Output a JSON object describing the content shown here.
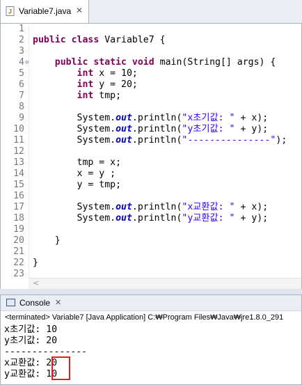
{
  "editor": {
    "tab_label": "Variable7.java",
    "tab_close": "✕",
    "lines": [
      {
        "n": "1",
        "parts": []
      },
      {
        "n": "2",
        "parts": [
          {
            "t": "public class",
            "c": "kw"
          },
          {
            "t": " Variable7 {",
            "c": ""
          }
        ]
      },
      {
        "n": "3",
        "parts": []
      },
      {
        "n": "4",
        "fold": "⊖",
        "parts": [
          {
            "t": "    ",
            "c": ""
          },
          {
            "t": "public static void",
            "c": "kw"
          },
          {
            "t": " main(String[] args) {",
            "c": ""
          }
        ]
      },
      {
        "n": "5",
        "parts": [
          {
            "t": "        ",
            "c": ""
          },
          {
            "t": "int",
            "c": "kw"
          },
          {
            "t": " x = 10;",
            "c": ""
          }
        ]
      },
      {
        "n": "6",
        "parts": [
          {
            "t": "        ",
            "c": ""
          },
          {
            "t": "int",
            "c": "kw"
          },
          {
            "t": " y = 20;",
            "c": ""
          }
        ]
      },
      {
        "n": "7",
        "parts": [
          {
            "t": "        ",
            "c": ""
          },
          {
            "t": "int",
            "c": "kw"
          },
          {
            "t": " tmp;",
            "c": ""
          }
        ]
      },
      {
        "n": "8",
        "parts": []
      },
      {
        "n": "9",
        "parts": [
          {
            "t": "        System.",
            "c": ""
          },
          {
            "t": "out",
            "c": "st"
          },
          {
            "t": ".println(",
            "c": ""
          },
          {
            "t": "\"x초기값: \"",
            "c": "str"
          },
          {
            "t": " + x);",
            "c": ""
          }
        ]
      },
      {
        "n": "10",
        "parts": [
          {
            "t": "        System.",
            "c": ""
          },
          {
            "t": "out",
            "c": "st"
          },
          {
            "t": ".println(",
            "c": ""
          },
          {
            "t": "\"y초기값: \"",
            "c": "str"
          },
          {
            "t": " + y);",
            "c": ""
          }
        ]
      },
      {
        "n": "11",
        "parts": [
          {
            "t": "        System.",
            "c": ""
          },
          {
            "t": "out",
            "c": "st"
          },
          {
            "t": ".println(",
            "c": ""
          },
          {
            "t": "\"---------------\"",
            "c": "str"
          },
          {
            "t": ");",
            "c": ""
          }
        ]
      },
      {
        "n": "12",
        "parts": []
      },
      {
        "n": "13",
        "parts": [
          {
            "t": "        tmp = x;",
            "c": ""
          }
        ]
      },
      {
        "n": "14",
        "parts": [
          {
            "t": "        x = y ;",
            "c": ""
          }
        ]
      },
      {
        "n": "15",
        "parts": [
          {
            "t": "        y = tmp;",
            "c": ""
          }
        ]
      },
      {
        "n": "16",
        "parts": []
      },
      {
        "n": "17",
        "parts": [
          {
            "t": "        System.",
            "c": ""
          },
          {
            "t": "out",
            "c": "st"
          },
          {
            "t": ".println(",
            "c": ""
          },
          {
            "t": "\"x교환값: \"",
            "c": "str"
          },
          {
            "t": " + x);",
            "c": ""
          }
        ]
      },
      {
        "n": "18",
        "parts": [
          {
            "t": "        System.",
            "c": ""
          },
          {
            "t": "out",
            "c": "st"
          },
          {
            "t": ".println(",
            "c": ""
          },
          {
            "t": "\"y교환값: \"",
            "c": "str"
          },
          {
            "t": " + y);",
            "c": ""
          }
        ]
      },
      {
        "n": "19",
        "parts": []
      },
      {
        "n": "20",
        "parts": [
          {
            "t": "    }",
            "c": ""
          }
        ]
      },
      {
        "n": "21",
        "parts": []
      },
      {
        "n": "22",
        "parts": [
          {
            "t": "}",
            "c": ""
          }
        ]
      },
      {
        "n": "23",
        "parts": []
      }
    ],
    "scroll_arrow": "<"
  },
  "console": {
    "tab_label": "Console",
    "tab_close": "✕",
    "terminated": "<terminated> Variable7 [Java Application] C:₩Program Files₩Java₩jre1.8.0_291",
    "output_lines": [
      "x초기값: 10",
      "y초기값: 20",
      "---------------",
      "x교환값: 20",
      "y교환값: 10"
    ]
  },
  "colors": {
    "keyword": "#7f0055",
    "string": "#2a00ff",
    "static_field": "#0000c0",
    "highlight_box": "#e02020"
  }
}
